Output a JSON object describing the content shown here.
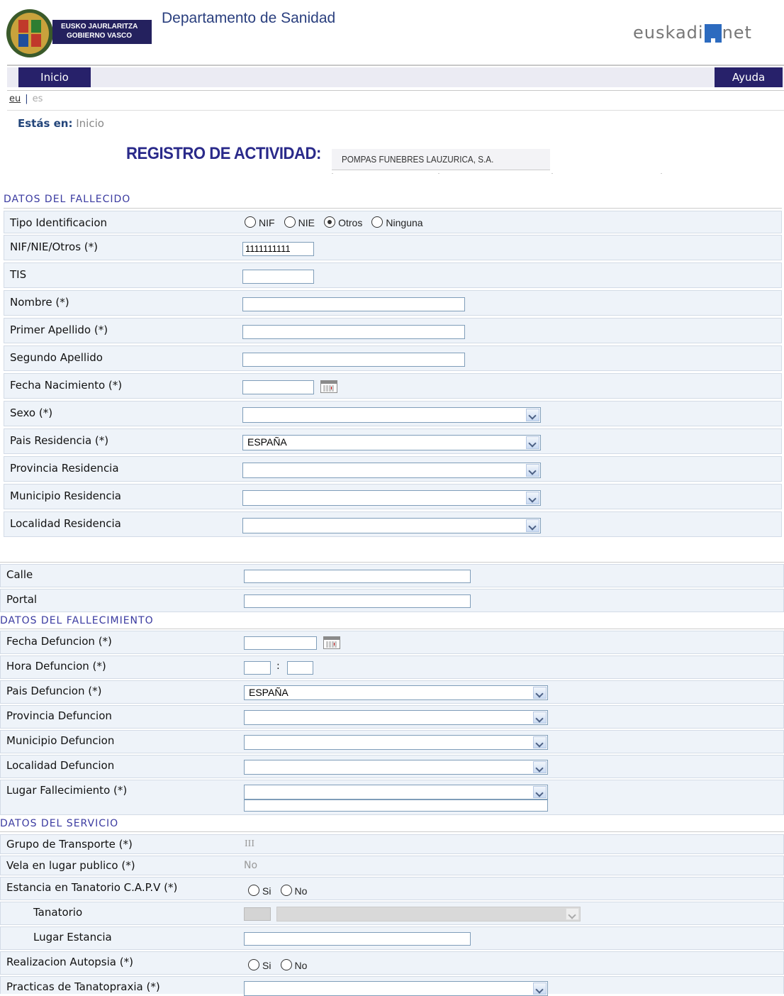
{
  "header": {
    "logo_line1": "EUSKO JAURLARITZA",
    "logo_line2": "GOBIERNO VASCO",
    "department": "Departamento de Sanidad",
    "brand_left": "euskadi",
    "brand_right": "net"
  },
  "nav": {
    "home": "Inicio",
    "help": "Ayuda"
  },
  "lang": {
    "eu": "eu",
    "sep": "|",
    "es": "es"
  },
  "breadcrumb": {
    "label": "Estás en:",
    "value": "Inicio"
  },
  "registro": {
    "title": "REGISTRO DE ACTIVIDAD:",
    "company": "POMPAS FUNEBRES LAUZURICA, S.A."
  },
  "fallecido": {
    "title": "DATOS DEL FALLECIDO",
    "tipo_label": "Tipo Identificacion",
    "tipo_options": [
      "NIF",
      "NIE",
      "Otros",
      "Ninguna"
    ],
    "tipo_selected": "Otros",
    "nif_label": "NIF/NIE/Otros (*)",
    "nif_value": "1111111111",
    "tis_label": "TIS",
    "nombre_label": "Nombre (*)",
    "apellido1_label": "Primer Apellido (*)",
    "apellido2_label": "Segundo Apellido",
    "fecha_label": "Fecha Nacimiento (*)",
    "sexo_label": "Sexo (*)",
    "pais_label": "Pais Residencia (*)",
    "pais_value": "ESPAÑA",
    "provincia_label": "Provincia Residencia",
    "municipio_label": "Municipio Residencia",
    "localidad_label": "Localidad Residencia",
    "calle_label": "Calle",
    "portal_label": "Portal"
  },
  "fallecimiento": {
    "title": "DATOS DEL FALLECIMIENTO",
    "fecha_label": "Fecha Defuncion (*)",
    "hora_label": "Hora Defuncion (*)",
    "hora_sep": ":",
    "pais_label": "Pais Defuncion (*)",
    "pais_value": "ESPAÑA",
    "provincia_label": "Provincia Defuncion",
    "municipio_label": "Municipio Defuncion",
    "localidad_label": "Localidad Defuncion",
    "lugar_label": "Lugar Fallecimiento (*)"
  },
  "servicio": {
    "title": "DATOS DEL SERVICIO",
    "grupo_label": "Grupo de Transporte (*)",
    "grupo_value": "III",
    "vela_label": "Vela en lugar publico (*)",
    "vela_value": "No",
    "estancia_label": "Estancia en Tanatorio C.A.P.V (*)",
    "tanatorio_label": "Tanatorio",
    "lugar_estancia_label": "Lugar Estancia",
    "autopsia_label": "Realizacion Autopsia (*)",
    "tanatopraxia_label": "Practicas de Tanatopraxia (*)",
    "yes": "Si",
    "no": "No"
  },
  "icons": [
    "government-seal-icon",
    "calendar-icon",
    "chevron-down-icon",
    "radio-icon"
  ],
  "colors": {
    "nav": "#27216a",
    "section": "#3a3aa0",
    "row": "#eef3f9",
    "brand": "#2d6bbf"
  }
}
